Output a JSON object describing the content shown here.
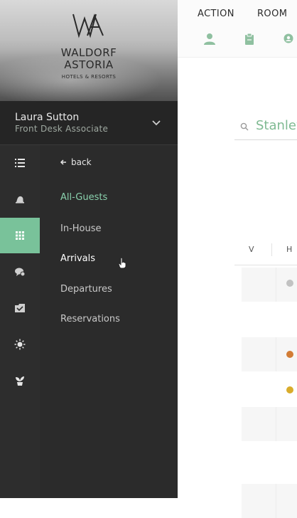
{
  "brand": {
    "monogram": "WA",
    "line1": "WALDORF",
    "line2": "ASTORIA",
    "line3": "HOTELS & RESORTS"
  },
  "user": {
    "name": "Laura Sutton",
    "role": "Front Desk Associate"
  },
  "rail_icons": [
    "list-icon",
    "bell-icon",
    "grid-icon",
    "chat-icon",
    "clipboard-check-icon",
    "sun-icon",
    "plant-icon"
  ],
  "submenu": {
    "back_label": "back",
    "items": [
      {
        "label": "All-Guests",
        "state": "active"
      },
      {
        "label": "In-House",
        "state": "normal"
      },
      {
        "label": "Arrivals",
        "state": "hover"
      },
      {
        "label": "Departures",
        "state": "normal"
      },
      {
        "label": "Reservations",
        "state": "normal"
      }
    ]
  },
  "top_nav": {
    "labels": [
      "ACTION",
      "ROOM"
    ],
    "icons": [
      "person-icon",
      "clipboard-icon",
      "person-search-icon"
    ]
  },
  "search": {
    "query": "Stanley"
  },
  "table": {
    "headers": [
      "V",
      "H"
    ],
    "status_colors": [
      "#c2c2c2",
      "#d27c35",
      "#d9ac2b"
    ]
  },
  "colors": {
    "accent": "#79c29a",
    "panel": "#2b2b2b",
    "search_text": "#7fba92"
  }
}
